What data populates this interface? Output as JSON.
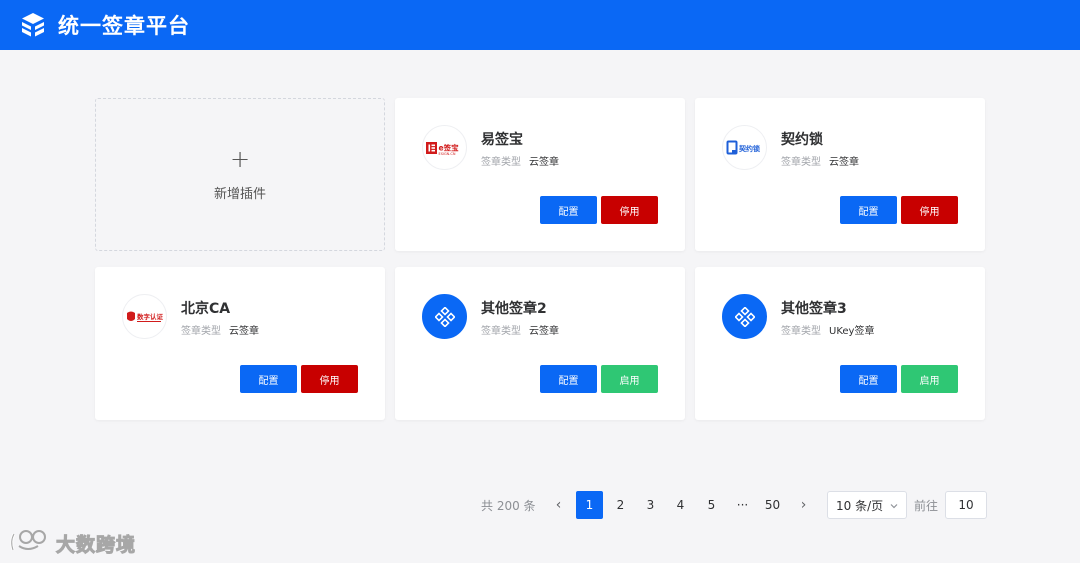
{
  "header": {
    "title": "统一签章平台",
    "logo_icon": "cube-logo-icon"
  },
  "add_card": {
    "plus": "+",
    "label": "新增插件"
  },
  "plugins": [
    {
      "name": "易签宝",
      "type_label": "签章类型",
      "type_value": "云签章",
      "logo_text": "e签宝",
      "logo_sub": "ESIGN.CN",
      "config_label": "配置",
      "toggle_label": "停用",
      "status": "enabled"
    },
    {
      "name": "契约锁",
      "type_label": "签章类型",
      "type_value": "云签章",
      "logo_text": "契约锁",
      "config_label": "配置",
      "toggle_label": "停用",
      "status": "enabled"
    },
    {
      "name": "北京CA",
      "type_label": "签章类型",
      "type_value": "云签章",
      "logo_text": "数字认证",
      "config_label": "配置",
      "toggle_label": "停用",
      "status": "enabled"
    },
    {
      "name": "其他签章2",
      "type_label": "签章类型",
      "type_value": "云签章",
      "config_label": "配置",
      "toggle_label": "启用",
      "status": "disabled"
    },
    {
      "name": "其他签章3",
      "type_label": "签章类型",
      "type_value": "UKey签章",
      "config_label": "配置",
      "toggle_label": "启用",
      "status": "disabled"
    }
  ],
  "pagination": {
    "total_text": "共 200 条",
    "pages": [
      "1",
      "2",
      "3",
      "4",
      "5",
      "···",
      "50"
    ],
    "current_page": "1",
    "page_size": "10 条/页",
    "goto_label": "前往",
    "goto_value": "10"
  },
  "watermark": {
    "text": "大数跨境"
  },
  "colors": {
    "primary": "#0a68f5",
    "stop": "#c80000",
    "start": "#2fc774",
    "background": "#f5f5f7"
  }
}
